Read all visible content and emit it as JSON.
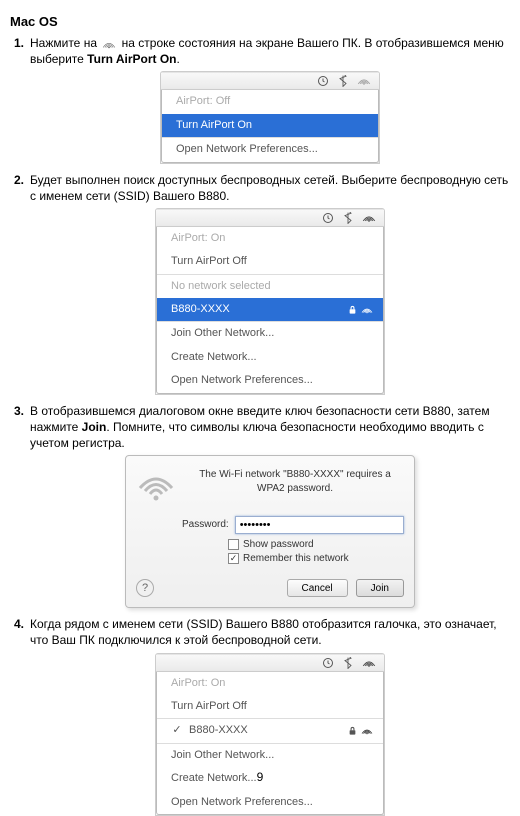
{
  "heading": "Mac OS",
  "page_number": "9",
  "steps": {
    "s1_num": "1.",
    "s1_a": "Нажмите на ",
    "s1_b": " на строке состояния на экране Вашего ПК. В отобразившемся меню выберите ",
    "s1_bold": "Turn AirPort On",
    "s1_c": ".",
    "s2_num": "2.",
    "s2": "Будет выполнен поиск доступных беспроводных сетей. Выберите беспроводную сеть с именем сети (SSID) Вашего B880.",
    "s3_num": "3.",
    "s3_a": "В отобразившемся диалоговом окне введите ключ безопасности сети B880, затем нажмите ",
    "s3_bold": "Join",
    "s3_b": ". Помните, что символы ключа безопасности необходимо вводить с учетом регистра.",
    "s4_num": "4.",
    "s4": "Когда рядом с именем сети (SSID) Вашего B880 отобразится галочка, это означает, что Ваш ПК подключился к этой беспроводной сети."
  },
  "menu1": {
    "airport_off": "AirPort: Off",
    "turn_on": "Turn AirPort On",
    "open_prefs": "Open Network Preferences..."
  },
  "menu2": {
    "airport_on": "AirPort: On",
    "turn_off": "Turn AirPort Off",
    "no_network": "No network selected",
    "ssid": "B880-XXXX",
    "join_other": "Join Other Network...",
    "create": "Create Network...",
    "open_prefs": "Open Network Preferences..."
  },
  "dialog": {
    "text1": "The Wi-Fi network \"B880-XXXX\" requires a WPA2 password.",
    "pw_label": "Password:",
    "pw_value": "••••••••",
    "show_pw": "Show password",
    "remember": "Remember this network",
    "cancel": "Cancel",
    "join": "Join",
    "help": "?"
  },
  "menu4": {
    "airport_on": "AirPort: On",
    "turn_off": "Turn AirPort Off",
    "check": "✓",
    "ssid": "B880-XXXX",
    "join_other": "Join Other Network...",
    "create": "Create Network...",
    "open_prefs": "Open Network Preferences..."
  }
}
